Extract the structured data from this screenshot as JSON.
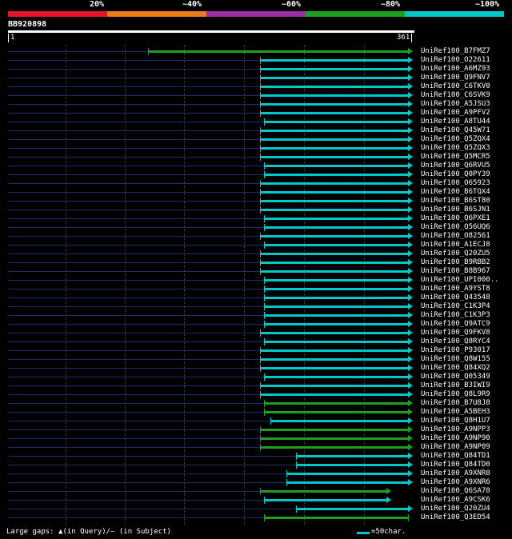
{
  "legend": {
    "labels": [
      "20%",
      "~40%",
      "~60%",
      "~80%",
      "~100%"
    ],
    "colors": [
      "#e8142c",
      "#ee7a1e",
      "#9b2ea0",
      "#1ea01e",
      "#00c8c8"
    ]
  },
  "query": {
    "name": "BB920898",
    "start": "1",
    "end": "361"
  },
  "hits": [
    {
      "label": "UniRef100_B7FMZ7",
      "start": 0.35,
      "color": "green",
      "arrow": true
    },
    {
      "label": "UniRef100_O22611",
      "start": 0.63,
      "color": "cyan",
      "arrow": true
    },
    {
      "label": "UniRef100_A6MZ93",
      "start": 0.63,
      "color": "cyan",
      "arrow": true
    },
    {
      "label": "UniRef100_Q9FNV7",
      "start": 0.63,
      "color": "cyan",
      "arrow": true
    },
    {
      "label": "UniRef100_C6TKV0",
      "start": 0.63,
      "color": "cyan",
      "arrow": true
    },
    {
      "label": "UniRef100_C6SVK9",
      "start": 0.63,
      "color": "cyan",
      "arrow": true
    },
    {
      "label": "UniRef100_A5JSU3",
      "start": 0.63,
      "color": "cyan",
      "arrow": true
    },
    {
      "label": "UniRef100_A9PFV2",
      "start": 0.63,
      "color": "cyan",
      "arrow": true
    },
    {
      "label": "UniRef100_A8TU44",
      "start": 0.64,
      "color": "cyan",
      "arrow": true
    },
    {
      "label": "UniRef100_Q45W71",
      "start": 0.63,
      "color": "cyan",
      "arrow": true
    },
    {
      "label": "UniRef100_Q5ZQX4",
      "start": 0.63,
      "color": "cyan",
      "arrow": true
    },
    {
      "label": "UniRef100_Q5ZQX3",
      "start": 0.63,
      "color": "cyan",
      "arrow": true
    },
    {
      "label": "UniRef100_Q5MCR5",
      "start": 0.63,
      "color": "cyan",
      "arrow": true
    },
    {
      "label": "UniRef100_Q6RVU5",
      "start": 0.64,
      "color": "cyan",
      "arrow": true
    },
    {
      "label": "UniRef100_Q0PY39",
      "start": 0.64,
      "color": "cyan",
      "arrow": true
    },
    {
      "label": "UniRef100_O65923",
      "start": 0.63,
      "color": "cyan",
      "arrow": true
    },
    {
      "label": "UniRef100_B6TQX4",
      "start": 0.63,
      "color": "cyan",
      "arrow": true
    },
    {
      "label": "UniRef100_B6ST80",
      "start": 0.63,
      "color": "cyan",
      "arrow": true
    },
    {
      "label": "UniRef100_B6SJN1",
      "start": 0.63,
      "color": "cyan",
      "arrow": true
    },
    {
      "label": "UniRef100_Q6PXE1",
      "start": 0.64,
      "color": "cyan",
      "arrow": true
    },
    {
      "label": "UniRef100_Q56UQ6",
      "start": 0.64,
      "color": "cyan",
      "arrow": true
    },
    {
      "label": "UniRef100_O82561",
      "start": 0.63,
      "color": "cyan",
      "arrow": true
    },
    {
      "label": "UniRef100_A1ECJ8",
      "start": 0.64,
      "color": "cyan",
      "arrow": true
    },
    {
      "label": "UniRef100_Q20ZU5",
      "start": 0.63,
      "color": "cyan",
      "arrow": true
    },
    {
      "label": "UniRef100_B9RBB2",
      "start": 0.63,
      "color": "cyan",
      "arrow": true
    },
    {
      "label": "UniRef100_B8B967",
      "start": 0.63,
      "color": "cyan",
      "arrow": true
    },
    {
      "label": "UniRef100_UPI000..",
      "start": 0.64,
      "color": "cyan",
      "arrow": true
    },
    {
      "label": "UniRef100_A9YST8",
      "start": 0.64,
      "color": "cyan",
      "arrow": true
    },
    {
      "label": "UniRef100_Q43548",
      "start": 0.64,
      "color": "cyan",
      "arrow": true
    },
    {
      "label": "UniRef100_C1K3P4",
      "start": 0.64,
      "color": "cyan",
      "arrow": true
    },
    {
      "label": "UniRef100_C1K3P3",
      "start": 0.64,
      "color": "cyan",
      "arrow": true
    },
    {
      "label": "UniRef100_Q9ATC9",
      "start": 0.64,
      "color": "cyan",
      "arrow": true
    },
    {
      "label": "UniRef100_Q9FKV8",
      "start": 0.63,
      "color": "cyan",
      "arrow": true
    },
    {
      "label": "UniRef100_Q8RYC4",
      "start": 0.64,
      "color": "cyan",
      "arrow": true
    },
    {
      "label": "UniRef100_P93017",
      "start": 0.63,
      "color": "cyan",
      "arrow": true
    },
    {
      "label": "UniRef100_Q8W155",
      "start": 0.63,
      "color": "cyan",
      "arrow": true
    },
    {
      "label": "UniRef100_Q84XQ2",
      "start": 0.63,
      "color": "cyan",
      "arrow": true
    },
    {
      "label": "UniRef100_Q05349",
      "start": 0.64,
      "color": "cyan",
      "arrow": true
    },
    {
      "label": "UniRef100_B3IWI9",
      "start": 0.63,
      "color": "cyan",
      "arrow": true
    },
    {
      "label": "UniRef100_Q8L9R9",
      "start": 0.63,
      "color": "cyan",
      "arrow": true
    },
    {
      "label": "UniRef100_B7U8J8",
      "start": 0.64,
      "color": "green",
      "arrow": true
    },
    {
      "label": "UniRef100_A5BEH3",
      "start": 0.64,
      "color": "green",
      "arrow": true
    },
    {
      "label": "UniRef100_Q8H1U7",
      "start": 0.655,
      "color": "cyan",
      "arrow": true
    },
    {
      "label": "UniRef100_A9NPP3",
      "start": 0.63,
      "color": "green",
      "arrow": true
    },
    {
      "label": "UniRef100_A9NP90",
      "start": 0.63,
      "color": "green",
      "arrow": true
    },
    {
      "label": "UniRef100_A9NP09",
      "start": 0.63,
      "color": "green",
      "arrow": true
    },
    {
      "label": "UniRef100_Q84TD1",
      "start": 0.72,
      "color": "cyan",
      "arrow": true
    },
    {
      "label": "UniRef100_Q84TD0",
      "start": 0.72,
      "color": "cyan",
      "arrow": true
    },
    {
      "label": "UniRef100_A9XNR8",
      "start": 0.695,
      "color": "cyan",
      "arrow": true
    },
    {
      "label": "UniRef100_A9XNR6",
      "start": 0.695,
      "color": "cyan",
      "arrow": true
    },
    {
      "label": "UniRef100_Q6SA78",
      "start": 0.63,
      "color": "green",
      "arrow": true,
      "end": 0.945
    },
    {
      "label": "UniRef100_A9CSK6",
      "start": 0.64,
      "color": "cyan",
      "arrow": true,
      "end": 0.945
    },
    {
      "label": "UniRef100_Q20ZU4",
      "start": 0.72,
      "color": "cyan",
      "arrow": true
    },
    {
      "label": "UniRef100_Q3ED54",
      "start": 0.64,
      "color": "green",
      "arrow": false
    }
  ],
  "footer": {
    "gaps": "Large gaps: ▲(in Query)/‒ (in Subject)",
    "scale": "=50char."
  }
}
